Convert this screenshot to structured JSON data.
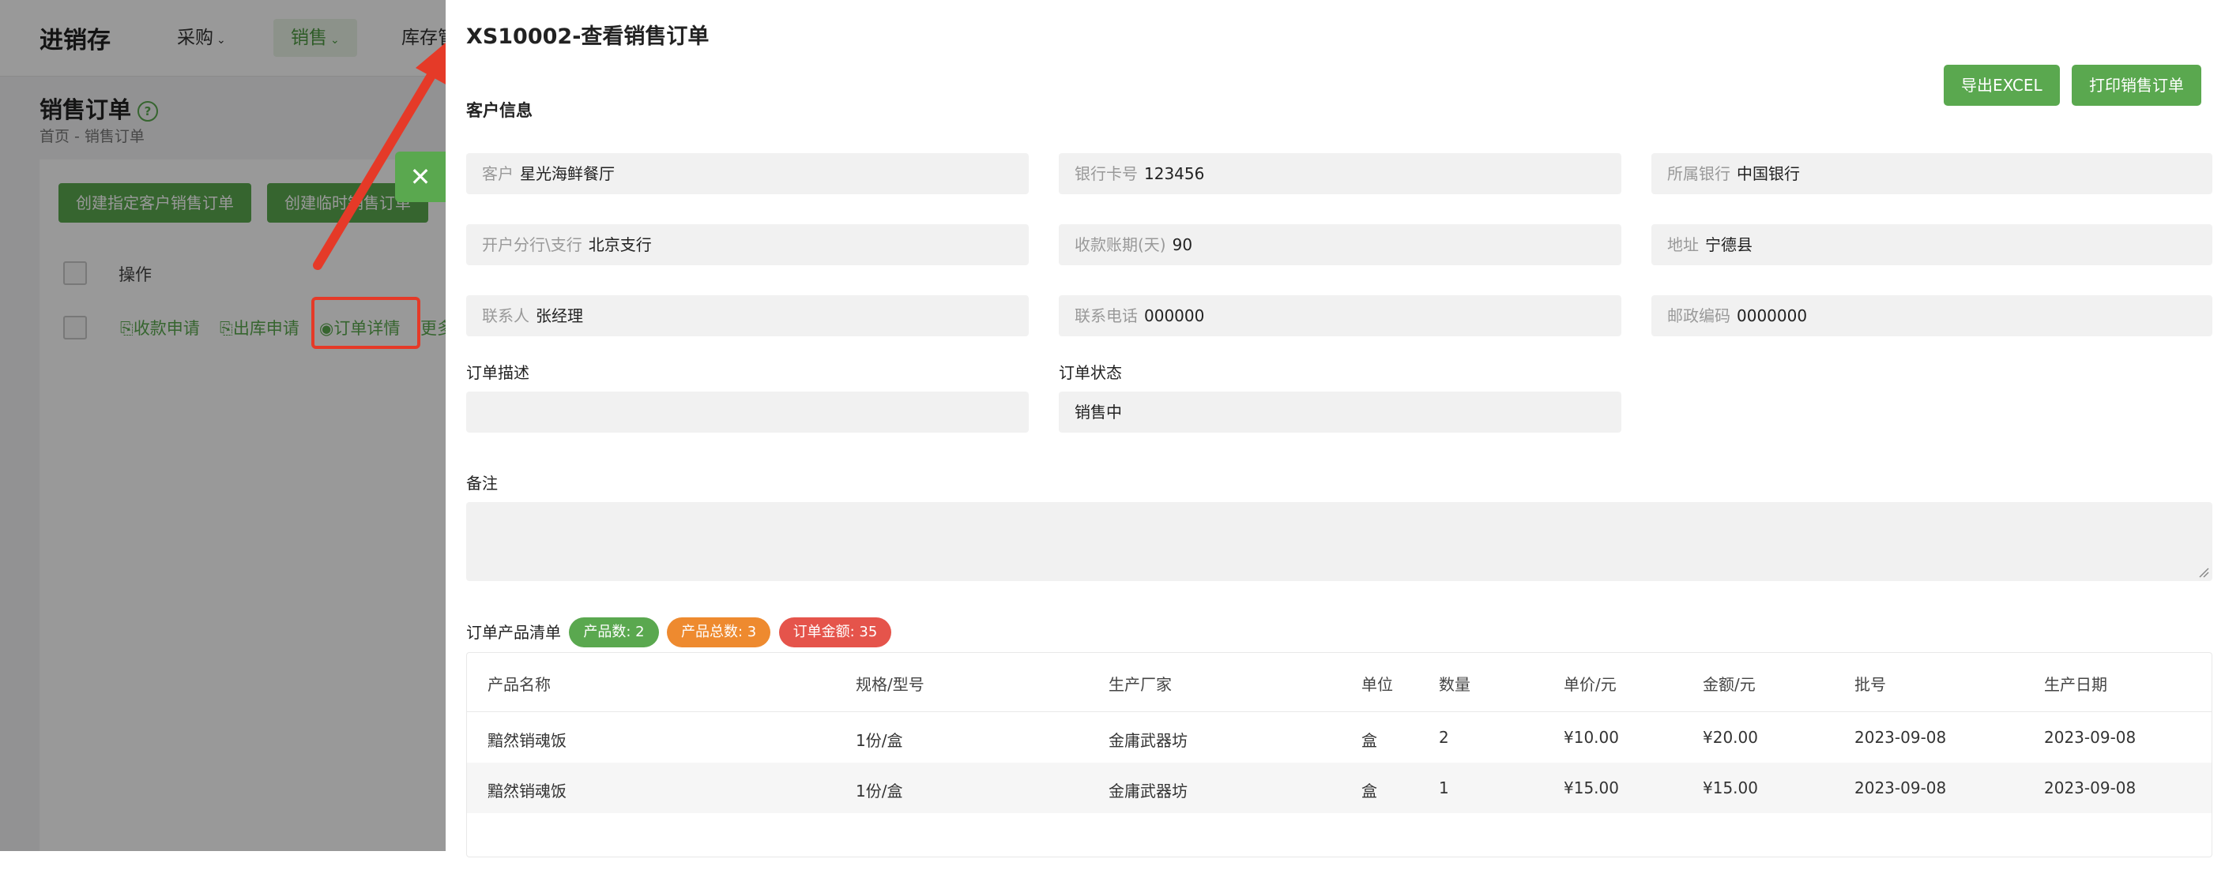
{
  "app": {
    "logo": "进销存",
    "nav": [
      "采购",
      "销售",
      "库存管"
    ],
    "page_title": "销售订单",
    "breadcrumb": "首页 - 销售订单",
    "buttons": [
      "创建指定客户销售订单",
      "创建临时销售订单"
    ],
    "col_operation": "操作",
    "row_links": [
      "收款申请",
      "出库申请",
      "订单详情",
      "更多"
    ]
  },
  "drawer": {
    "title": "XS10002-查看销售订单",
    "export_label": "导出EXCEL",
    "print_label": "打印销售订单",
    "section_customer": "客户信息",
    "fields": {
      "customer": {
        "label": "客户",
        "value": "星光海鲜餐厅"
      },
      "bank_card": {
        "label": "银行卡号",
        "value": "123456"
      },
      "bank": {
        "label": "所属银行",
        "value": "中国银行"
      },
      "branch": {
        "label": "开户分行\\支行",
        "value": "北京支行"
      },
      "payment_days": {
        "label": "收款账期(天)",
        "value": "90"
      },
      "address": {
        "label": "地址",
        "value": "宁德县"
      },
      "contact": {
        "label": "联系人",
        "value": "张经理"
      },
      "phone": {
        "label": "联系电话",
        "value": "000000"
      },
      "postcode": {
        "label": "邮政编码",
        "value": "0000000"
      }
    },
    "order_desc_label": "订单描述",
    "order_desc_value": "",
    "order_status_label": "订单状态",
    "order_status_value": "销售中",
    "remark_label": "备注",
    "remark_value": "",
    "product_list_label": "订单产品清单",
    "tags": [
      {
        "text": "产品数: 2",
        "color": "#5aa84f"
      },
      {
        "text": "产品总数: 3",
        "color": "#ee8a2f"
      },
      {
        "text": "订单金额: 35",
        "color": "#e5544b"
      }
    ],
    "table": {
      "headers": [
        "产品名称",
        "规格/型号",
        "生产厂家",
        "单位",
        "数量",
        "单价/元",
        "金额/元",
        "批号",
        "生产日期"
      ],
      "rows": [
        [
          "黯然销魂饭",
          "1份/盒",
          "金庸武器坊",
          "盒",
          "2",
          "¥10.00",
          "¥20.00",
          "2023-09-08",
          "2023-09-08"
        ],
        [
          "黯然销魂饭",
          "1份/盒",
          "金庸武器坊",
          "盒",
          "1",
          "¥15.00",
          "¥15.00",
          "2023-09-08",
          "2023-09-08"
        ]
      ]
    }
  },
  "colors": {
    "primary": "#5aa84f",
    "annotation": "#e53a28"
  }
}
